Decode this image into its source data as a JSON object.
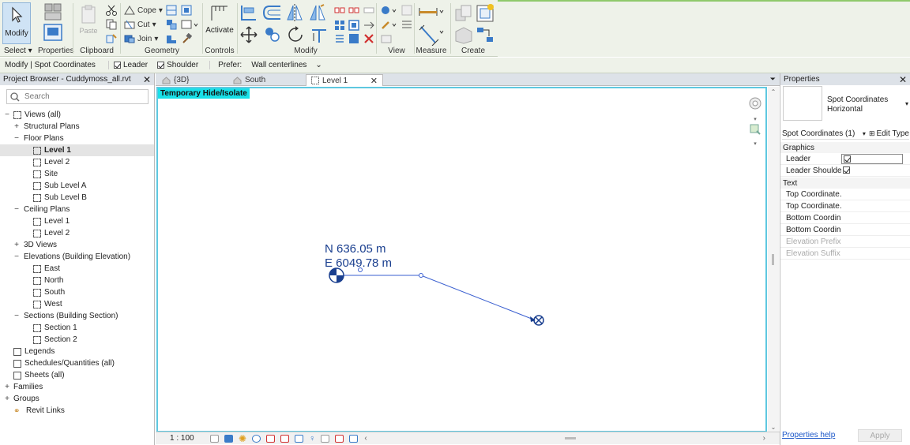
{
  "ribbon": {
    "modify_label": "Modify",
    "select_label": "Select",
    "properties_label": "Properties",
    "clipboard_label": "Clipboard",
    "paste_label": "Paste",
    "cope_label": "Cope",
    "cut_label": "Cut",
    "join_label": "Join",
    "geometry_label": "Geometry",
    "activate_label": "Activate",
    "controls_label": "Controls",
    "modify_group_label": "Modify",
    "view_label": "View",
    "measure_label": "Measure",
    "create_label": "Create"
  },
  "options_bar": {
    "context": "Modify | Spot Coordinates",
    "leader_label": "Leader",
    "shoulder_label": "Shoulder",
    "prefer_label": "Prefer:",
    "prefer_value": "Wall centerlines"
  },
  "project_browser": {
    "title": "Project Browser - Cuddymoss_all.rvt",
    "search_placeholder": "Search",
    "items": [
      {
        "label": "Views (all)",
        "level": 0,
        "toggle": "−",
        "icon": "views"
      },
      {
        "label": "Structural Plans",
        "level": 1,
        "toggle": "+"
      },
      {
        "label": "Floor Plans",
        "level": 1,
        "toggle": "−"
      },
      {
        "label": "Level 1",
        "level": 2,
        "icon": "view",
        "selected": true
      },
      {
        "label": "Level 2",
        "level": 2,
        "icon": "view"
      },
      {
        "label": "Site",
        "level": 2,
        "icon": "view"
      },
      {
        "label": "Sub Level A",
        "level": 2,
        "icon": "view"
      },
      {
        "label": "Sub Level B",
        "level": 2,
        "icon": "view"
      },
      {
        "label": "Ceiling Plans",
        "level": 1,
        "toggle": "−"
      },
      {
        "label": "Level 1",
        "level": 2,
        "icon": "view"
      },
      {
        "label": "Level 2",
        "level": 2,
        "icon": "view"
      },
      {
        "label": "3D Views",
        "level": 1,
        "toggle": "+"
      },
      {
        "label": "Elevations (Building Elevation)",
        "level": 1,
        "toggle": "−"
      },
      {
        "label": "East",
        "level": 2,
        "icon": "view"
      },
      {
        "label": "North",
        "level": 2,
        "icon": "view"
      },
      {
        "label": "South",
        "level": 2,
        "icon": "view"
      },
      {
        "label": "West",
        "level": 2,
        "icon": "view"
      },
      {
        "label": "Sections (Building Section)",
        "level": 1,
        "toggle": "−"
      },
      {
        "label": "Section 1",
        "level": 2,
        "icon": "view"
      },
      {
        "label": "Section 2",
        "level": 2,
        "icon": "view"
      },
      {
        "label": "Legends",
        "level": 0,
        "icon": "legend"
      },
      {
        "label": "Schedules/Quantities (all)",
        "level": 0,
        "icon": "schedule"
      },
      {
        "label": "Sheets (all)",
        "level": 0,
        "icon": "sheet"
      },
      {
        "label": "Families",
        "level": 0,
        "toggle": "+"
      },
      {
        "label": "Groups",
        "level": 0,
        "toggle": "+"
      },
      {
        "label": "Revit Links",
        "level": 0,
        "icon": "link"
      }
    ]
  },
  "tabs": [
    {
      "label": "{3D}"
    },
    {
      "label": "South"
    },
    {
      "label": "Level 1",
      "active": true
    }
  ],
  "canvas": {
    "temp_badge": "Temporary Hide/Isolate",
    "spot_n": "N 636.05 m",
    "spot_e": "E 6049.78 m"
  },
  "status": {
    "scale": "1 : 100"
  },
  "properties": {
    "title": "Properties",
    "type_name": "Spot Coordinates Horizontal",
    "instance_label": "Spot Coordinates (1)",
    "edit_type": "Edit Type",
    "categories": {
      "graphics": "Graphics",
      "text": "Text"
    },
    "rows": {
      "leader": "Leader",
      "leader_shoulder": "Leader Shoulder",
      "top1": "Top Coordinate...",
      "top2": "Top Coordinate...",
      "bot1": "Bottom Coordin...",
      "bot2": "Bottom Coordin...",
      "elev_prefix": "Elevation Prefix",
      "elev_suffix": "Elevation Suffix"
    },
    "help_link": "Properties help",
    "apply_label": "Apply"
  }
}
